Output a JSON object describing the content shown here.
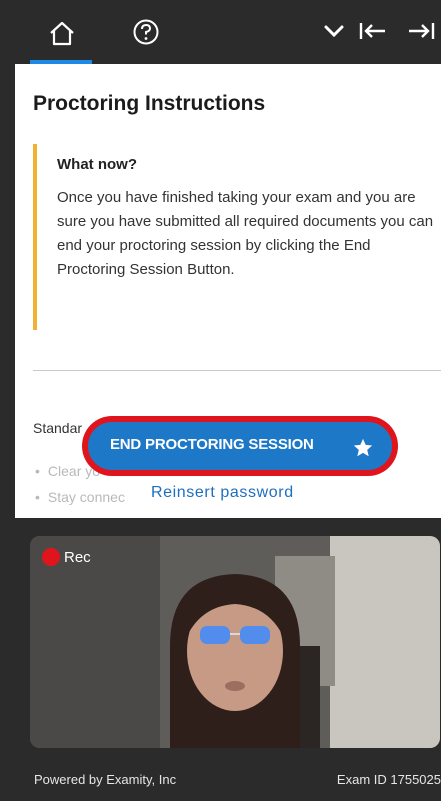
{
  "toolbar": {
    "tabs": [
      {
        "icon": "home-icon"
      },
      {
        "icon": "help-icon"
      }
    ],
    "right_icons": [
      "chevron-down-icon",
      "collapse-left-icon",
      "expand-right-icon"
    ],
    "accent_color": "#1e88e5"
  },
  "panel": {
    "title": "Proctoring Instructions",
    "callout": {
      "heading": "What now?",
      "body": "Once you have finished taking your exam and you are sure you have submitted all required documents you can end your proctoring session by clicking the End Proctoring Session Button.",
      "accent_color": "#f2b134"
    },
    "section_label": "Standar",
    "bullets": [
      "Clear yo",
      "Stay connec"
    ],
    "reinsert_link": "Reinsert password",
    "end_button": {
      "label": "END PROCTORING SESSION",
      "icon": "star-icon",
      "color": "#1e78c8",
      "highlight_color": "#e0141c"
    }
  },
  "video": {
    "rec_label": "Rec"
  },
  "footer": {
    "powered_by": "Powered by Examity, Inc",
    "exam_id": "Exam ID 1755025"
  }
}
